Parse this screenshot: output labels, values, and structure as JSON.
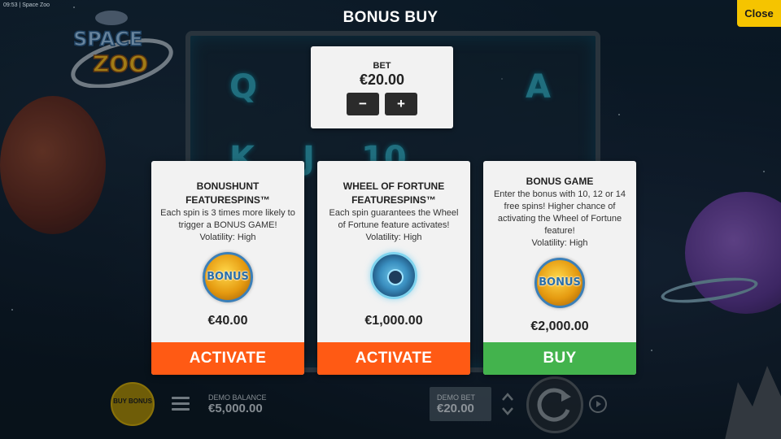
{
  "status_bar": {
    "text": "09:53 | Space Zoo"
  },
  "logo": {
    "text_line1": "SPACE",
    "text_line2": "ZOO"
  },
  "reel_symbols": [
    "Q",
    "A",
    "K",
    "J",
    "10"
  ],
  "header": {
    "title": "BONUS BUY",
    "close_label": "Close"
  },
  "bet": {
    "label": "BET",
    "value": "€20.00",
    "minus": "−",
    "plus": "+"
  },
  "cards": [
    {
      "title": "BONUSHUNT FEATURESPINS™",
      "description": "Each spin is 3 times more likely to trigger a BONUS GAME!",
      "volatility": "Volatility: High",
      "icon": "bonus-coin-icon",
      "icon_text": "BONUS",
      "price": "€40.00",
      "action": "ACTIVATE"
    },
    {
      "title": "WHEEL OF FORTUNE FEATURESPINS™",
      "description": "Each spin guarantees the Wheel of Fortune feature activates!",
      "volatility": "Volatility: High",
      "icon": "wheel-of-fortune-icon",
      "price": "€1,000.00",
      "action": "ACTIVATE"
    },
    {
      "title": "BONUS GAME",
      "description": "Enter the bonus with 10, 12 or 14 free spins! Higher chance of activating the Wheel of Fortune feature!",
      "volatility": "Volatility: High",
      "icon": "bonus-coin-icon",
      "icon_text": "BONUS",
      "price": "€2,000.00",
      "action": "BUY"
    }
  ],
  "bottom_bar": {
    "buy_bonus_label": "BUY BONUS",
    "demo_balance_label": "DEMO BALANCE",
    "demo_balance_value": "€5,000.00",
    "demo_bet_label": "DEMO BET",
    "demo_bet_value": "€20.00"
  },
  "colors": {
    "close_button": "#f5c400",
    "activate_button": "#ff5a14",
    "buy_button": "#43b34d",
    "card_bg": "#f2f2f2"
  }
}
